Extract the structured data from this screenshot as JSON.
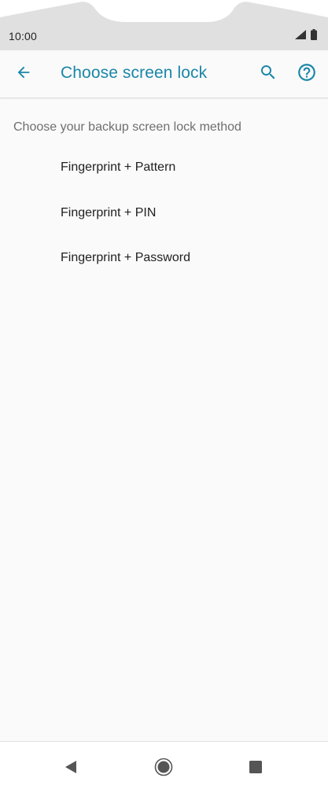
{
  "status_bar": {
    "time": "10:00",
    "icons": [
      "signal-icon",
      "battery-icon"
    ]
  },
  "app_bar": {
    "title": "Choose screen lock",
    "back_icon": "arrow-back-icon",
    "search_icon": "search-icon",
    "help_icon": "help-icon"
  },
  "content": {
    "section_header": "Choose your backup screen lock method",
    "options": [
      {
        "label": "Fingerprint + Pattern"
      },
      {
        "label": "Fingerprint + PIN"
      },
      {
        "label": "Fingerprint + Password"
      }
    ]
  },
  "nav_bar": {
    "icons": [
      "nav-back-icon",
      "nav-home-icon",
      "nav-recents-icon"
    ]
  },
  "colors": {
    "accent": "#1a86a8",
    "status_bar_bg": "#e0e0e0",
    "background": "#fafafa",
    "primary_text": "#212121",
    "secondary_text": "#6f6f6f"
  }
}
